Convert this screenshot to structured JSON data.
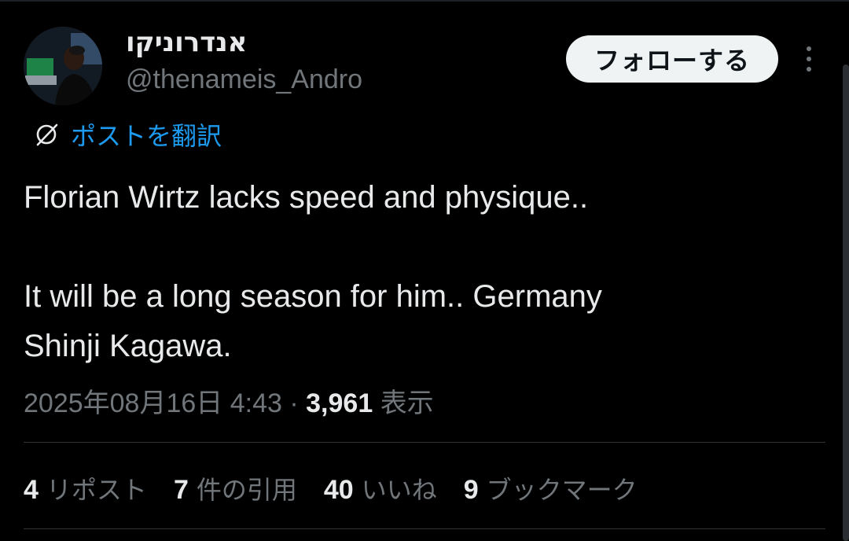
{
  "author": {
    "display_name": "אנדרוניקו",
    "handle": "@thenameis_Andro"
  },
  "actions": {
    "follow_label": "フォローする"
  },
  "translate": {
    "label": "ポストを翻訳"
  },
  "tweet": {
    "text": "Florian Wirtz lacks speed and physique..\n\nIt will be a long season for him.. Germany\nShinji Kagawa."
  },
  "meta": {
    "timestamp": "2025年08月16日 4:43",
    "separator": "·",
    "views_count": "3,961",
    "views_label": "表示"
  },
  "stats": [
    {
      "count": "4",
      "label": "リポスト"
    },
    {
      "count": "7",
      "label": "件の引用"
    },
    {
      "count": "40",
      "label": "いいね"
    },
    {
      "count": "9",
      "label": "ブックマーク"
    }
  ],
  "colors": {
    "background": "#000000",
    "text_primary": "#e7e9ea",
    "text_secondary": "#71767b",
    "link": "#1d9bf0",
    "follow_button_bg": "#eff3f4"
  }
}
